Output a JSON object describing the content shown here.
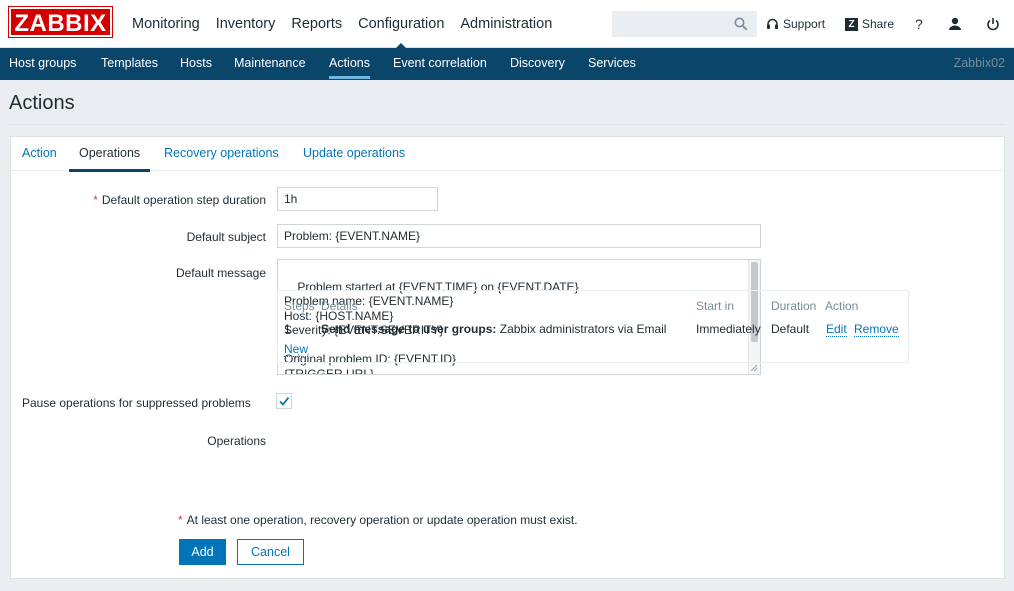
{
  "header": {
    "logo": "ZABBIX",
    "nav": [
      "Monitoring",
      "Inventory",
      "Reports",
      "Configuration",
      "Administration"
    ],
    "active_nav": "Configuration",
    "search": {
      "value": "",
      "placeholder": ""
    },
    "support_label": "Support",
    "share_label": "Share",
    "share_badge": "Z",
    "help_label": "?"
  },
  "subnav": {
    "items": [
      "Host groups",
      "Templates",
      "Hosts",
      "Maintenance",
      "Actions",
      "Event correlation",
      "Discovery",
      "Services"
    ],
    "active": "Actions",
    "server_name": "Zabbix02"
  },
  "page": {
    "title": "Actions"
  },
  "tabs": [
    "Action",
    "Operations",
    "Recovery operations",
    "Update operations"
  ],
  "active_tab": "Operations",
  "form": {
    "required_mark": "*",
    "step_duration_label": "Default operation step duration",
    "step_duration_value": "1h",
    "subject_label": "Default subject",
    "subject_value": "Problem: {EVENT.NAME}",
    "message_label": "Default message",
    "message_value": "Problem started at {EVENT.TIME} on {EVENT.DATE}\nProblem name: {EVENT.NAME}\nHost: {HOST.NAME}\nSeverity: {EVENT.SEVERITY}\n\nOriginal problem ID: {EVENT.ID}\n{TRIGGER.URL}",
    "pause_label": "Pause operations for suppressed problems",
    "pause_checked": true,
    "operations_label": "Operations"
  },
  "operations_table": {
    "headers": {
      "steps": "Steps",
      "details": "Details",
      "start_in": "Start in",
      "duration": "Duration",
      "action": "Action"
    },
    "rows": [
      {
        "step": "1",
        "details_bold": "Send message to user groups:",
        "details_rest": "Zabbix administrators via Email",
        "start_in": "Immediately",
        "duration": "Default",
        "edit": "Edit",
        "remove": "Remove"
      }
    ],
    "new_label": "New"
  },
  "validation_note": "At least one operation, recovery operation or update operation must exist.",
  "buttons": {
    "add": "Add",
    "cancel": "Cancel"
  },
  "colors": {
    "brand_red": "#d40000",
    "nav_blue": "#0a466a",
    "link_blue": "#0275b8",
    "required": "#e33734"
  }
}
